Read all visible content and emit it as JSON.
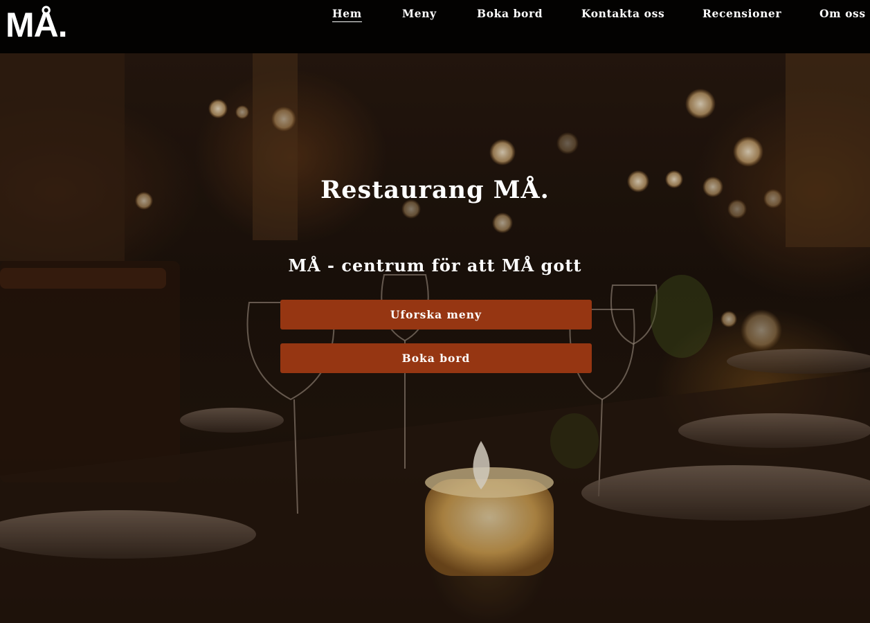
{
  "brand": {
    "logo": "MÅ."
  },
  "nav": {
    "items": [
      {
        "label": "Hem",
        "active": true
      },
      {
        "label": "Meny",
        "active": false
      },
      {
        "label": "Boka bord",
        "active": false
      },
      {
        "label": "Kontakta oss",
        "active": false
      },
      {
        "label": "Recensioner",
        "active": false
      },
      {
        "label": "Om oss",
        "active": false
      }
    ]
  },
  "hero": {
    "title": "Restaurang MÅ.",
    "subtitle": "MÅ - centrum för att MÅ gott",
    "buttons": {
      "explore_menu": "Uforska meny",
      "book_table": "Boka bord"
    },
    "colors": {
      "button_background": "#963612",
      "header_background": "#030201"
    }
  }
}
